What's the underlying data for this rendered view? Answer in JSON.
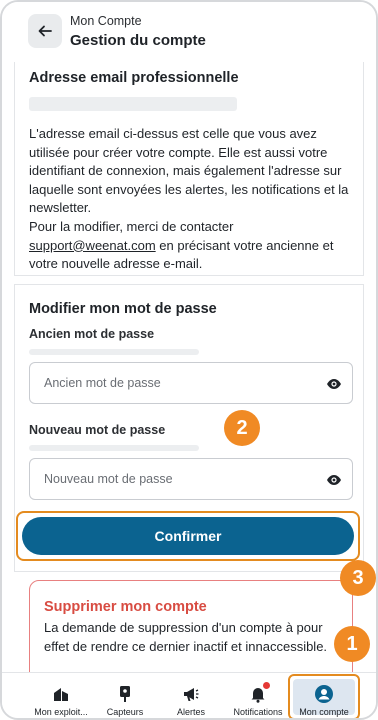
{
  "header": {
    "subtitle": "Mon Compte",
    "title": "Gestion du compte"
  },
  "email_section": {
    "title": "Adresse email professionnelle",
    "paragraph1": "L'adresse email ci-dessus est celle que vous avez utilisée pour créer votre compte. Elle est aussi votre identifiant de connexion, mais également l'adresse sur laquelle sont envoyées les alertes, les notifications et la newsletter.",
    "paragraph2_prefix": "Pour la modifier, merci de contacter",
    "support_email": "support@weenat.com",
    "paragraph2_suffix": "en précisant votre ancienne et votre nouvelle adresse e-mail."
  },
  "password_section": {
    "title": "Modifier mon mot de passe",
    "old_label": "Ancien mot de passe",
    "old_placeholder": "Ancien mot de passe",
    "new_label": "Nouveau mot de passe",
    "new_placeholder": "Nouveau mot de passe",
    "confirm_label": "Confirmer"
  },
  "delete_section": {
    "title": "Supprimer mon compte",
    "text": "La demande de suppression d'un compte à pour effet de rendre ce dernier inactif et innaccessible."
  },
  "bottom_nav": [
    {
      "label": "Mon exploit...",
      "icon": "farm-icon"
    },
    {
      "label": "Capteurs",
      "icon": "sensor-icon"
    },
    {
      "label": "Alertes",
      "icon": "megaphone-icon"
    },
    {
      "label": "Notifications",
      "icon": "bell-icon"
    },
    {
      "label": "Mon compte",
      "icon": "account-icon"
    }
  ],
  "badges": [
    "1",
    "2",
    "3"
  ],
  "colors": {
    "primary": "#0b6390",
    "danger": "#d84c42",
    "highlight": "#e48b1f",
    "badge": "#f08a24"
  }
}
